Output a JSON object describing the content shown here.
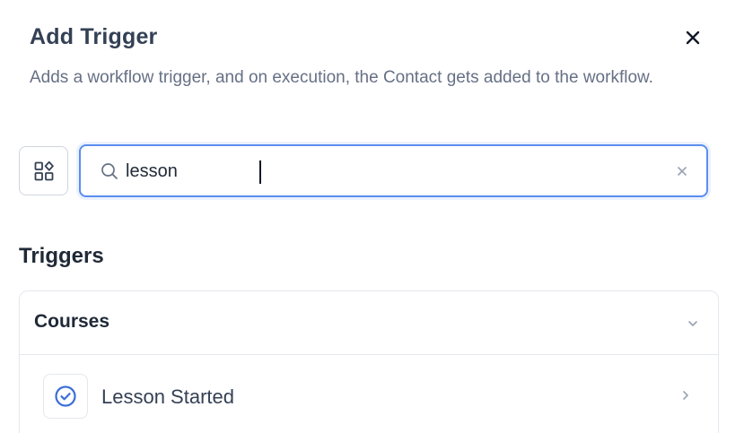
{
  "header": {
    "title": "Add Trigger",
    "description": "Adds a workflow trigger, and on execution, the Contact gets added to the workflow.",
    "close_icon": "close-icon"
  },
  "search": {
    "value": "lesson",
    "placeholder": "",
    "search_icon": "search-icon",
    "clear_icon": "clear-icon",
    "filter_icon": "category-grid-icon"
  },
  "section": {
    "title": "Triggers"
  },
  "groups": [
    {
      "label": "Courses",
      "expanded": true,
      "items": [
        {
          "label": "Lesson Started",
          "icon": "check-circle-icon"
        }
      ]
    }
  ],
  "colors": {
    "accent": "#5b8def",
    "icon_blue": "#3b6fd8",
    "text_primary": "#1f2937",
    "text_muted": "#667085",
    "border": "#e4e7ec"
  }
}
